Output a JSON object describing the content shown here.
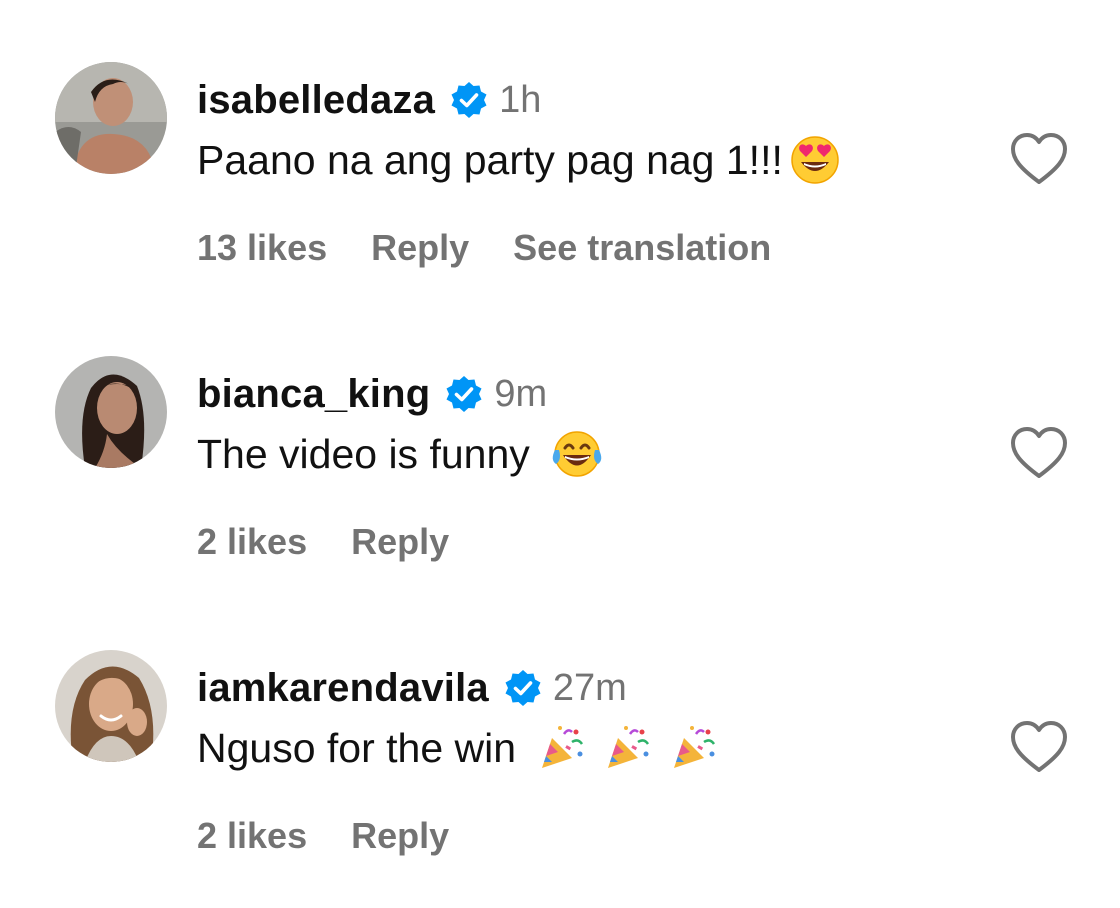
{
  "comments": [
    {
      "username": "isabelledaza",
      "time": "1h",
      "text": "Paano na ang party pag nag 1!!!",
      "emoji": "heart-eyes-emoji",
      "likes": "13 likes",
      "reply": "Reply",
      "translate": "See translation"
    },
    {
      "username": "bianca_king",
      "time": "9m",
      "text": "The video is funny",
      "emoji": "tears-of-joy-emoji",
      "likes": "2 likes",
      "reply": "Reply"
    },
    {
      "username": "iamkarendavila",
      "time": "27m",
      "text": "Nguso for the win",
      "emoji": "party-popper-emoji",
      "likes": "2 likes",
      "reply": "Reply"
    }
  ],
  "colors": {
    "verified": "#0095f6",
    "secondary_text": "#737373",
    "primary_text": "#111111"
  },
  "icons": {
    "verified": "verified-badge-icon",
    "like": "heart-outline-icon"
  }
}
